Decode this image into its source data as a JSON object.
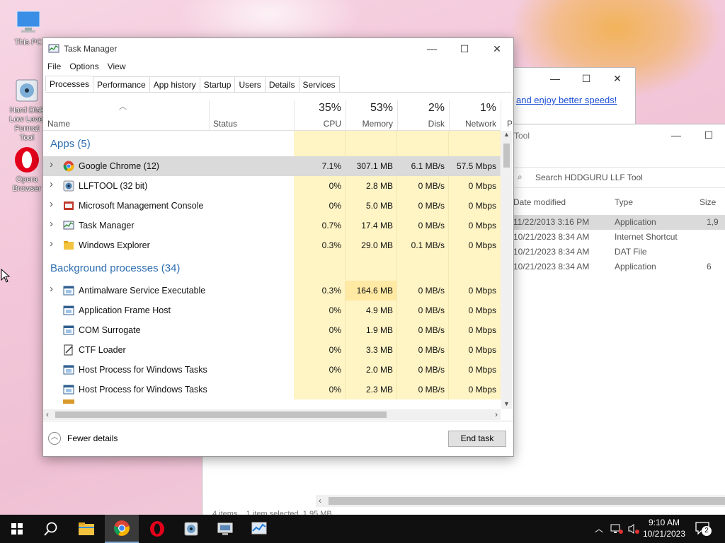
{
  "desktop": {
    "icons": [
      {
        "label": "This PC"
      },
      {
        "label": "Hard Disk Low Level Format Tool"
      },
      {
        "label": "Opera Browser"
      }
    ]
  },
  "bg_window_1": {
    "link_text": "and enjoy better speeds!"
  },
  "bg_window_2": {
    "title": "Tool",
    "search_placeholder": "Search HDDGURU LLF Tool",
    "columns": [
      "Date modified",
      "Type",
      "Size"
    ],
    "rows": [
      {
        "date": "11/22/2013 3:16 PM",
        "type": "Application",
        "size": "1,9"
      },
      {
        "date": "10/21/2023 8:34 AM",
        "type": "Internet Shortcut",
        "size": ""
      },
      {
        "date": "10/21/2023 8:34 AM",
        "type": "DAT File",
        "size": ""
      },
      {
        "date": "10/21/2023 8:34 AM",
        "type": "Application",
        "size": "6"
      }
    ],
    "status": "4 items    1 item selected  1.95 MB"
  },
  "task_manager": {
    "title": "Task Manager",
    "menu": [
      "File",
      "Options",
      "View"
    ],
    "tabs": [
      "Processes",
      "Performance",
      "App history",
      "Startup",
      "Users",
      "Details",
      "Services"
    ],
    "columns": {
      "name": "Name",
      "status": "Status",
      "cpu": {
        "pct": "35%",
        "label": "CPU"
      },
      "memory": {
        "pct": "53%",
        "label": "Memory"
      },
      "disk": {
        "pct": "2%",
        "label": "Disk"
      },
      "network": {
        "pct": "1%",
        "label": "Network"
      },
      "power": "P"
    },
    "apps_group": "Apps (5)",
    "apps": [
      {
        "name": "Google Chrome (12)",
        "cpu": "7.1%",
        "memory": "307.1 MB",
        "disk": "6.1 MB/s",
        "network": "57.5 Mbps"
      },
      {
        "name": "LLFTOOL (32 bit)",
        "cpu": "0%",
        "memory": "2.8 MB",
        "disk": "0 MB/s",
        "network": "0 Mbps"
      },
      {
        "name": "Microsoft Management Console",
        "cpu": "0%",
        "memory": "5.0 MB",
        "disk": "0 MB/s",
        "network": "0 Mbps"
      },
      {
        "name": "Task Manager",
        "cpu": "0.7%",
        "memory": "17.4 MB",
        "disk": "0 MB/s",
        "network": "0 Mbps"
      },
      {
        "name": "Windows Explorer",
        "cpu": "0.3%",
        "memory": "29.0 MB",
        "disk": "0.1 MB/s",
        "network": "0 Mbps"
      }
    ],
    "bg_group": "Background processes (34)",
    "background": [
      {
        "name": "Antimalware Service Executable",
        "cpu": "0.3%",
        "memory": "164.6 MB",
        "disk": "0 MB/s",
        "network": "0 Mbps"
      },
      {
        "name": "Application Frame Host",
        "cpu": "0%",
        "memory": "4.9 MB",
        "disk": "0 MB/s",
        "network": "0 Mbps"
      },
      {
        "name": "COM Surrogate",
        "cpu": "0%",
        "memory": "1.9 MB",
        "disk": "0 MB/s",
        "network": "0 Mbps"
      },
      {
        "name": "CTF Loader",
        "cpu": "0%",
        "memory": "3.3 MB",
        "disk": "0 MB/s",
        "network": "0 Mbps"
      },
      {
        "name": "Host Process for Windows Tasks",
        "cpu": "0%",
        "memory": "2.0 MB",
        "disk": "0 MB/s",
        "network": "0 Mbps"
      },
      {
        "name": "Host Process for Windows Tasks",
        "cpu": "0%",
        "memory": "2.3 MB",
        "disk": "0 MB/s",
        "network": "0 Mbps"
      }
    ],
    "fewer_details": "Fewer details",
    "end_task": "End task"
  },
  "taskbar": {
    "clock_time": "9:10 AM",
    "clock_date": "10/21/2023",
    "notification_count": "2"
  },
  "colors": {
    "accent_blue": "#2d6db0",
    "heat_low": "#fff4c4",
    "heat_mid": "#ffe9a3",
    "selected_row": "#dadada"
  }
}
